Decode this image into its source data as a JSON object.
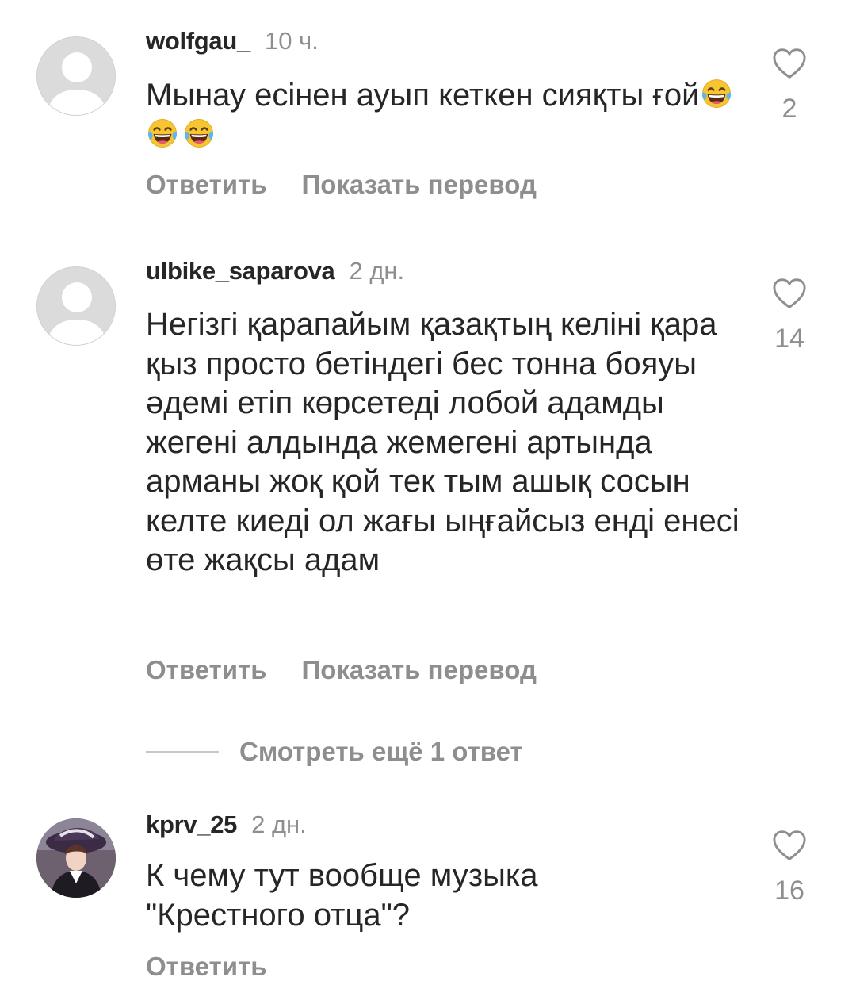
{
  "comments": [
    {
      "username": "wolfgau_",
      "time": "10 ч.",
      "text": "Мынау есінен ауып кеткен сияқты ғой",
      "emoji_count": 3,
      "emoji_icon": "laughing-tears-emoji",
      "likes": "2",
      "reply_label": "Ответить",
      "translate_label": "Показать перевод"
    },
    {
      "username": "ulbike_saparova",
      "time": "2 дн.",
      "text": "Негізгі қарапайым қазақтың келіні қара қыз просто бетіндегі бес тонна бояуы әдемі етіп көрсетеді лобой адамды жегені алдында жемегені артында арманы жоқ қой тек тым ашық сосын келте киеді ол жағы ыңғайсыз енді енесі өте жақсы адам",
      "likes": "14",
      "reply_label": "Ответить",
      "translate_label": "Показать перевод",
      "more_replies_label": "Смотреть ещё 1 ответ"
    },
    {
      "username": "kprv_25",
      "time": "2 дн.",
      "text": "К чему тут вообще музыка \"Крестного отца\"?",
      "likes": "16",
      "reply_label": "Ответить"
    }
  ],
  "icons": {
    "like": "heart-outline-icon",
    "default_avatar": "default-avatar-icon"
  },
  "colors": {
    "text": "#262626",
    "secondary": "#8e8e8e",
    "avatar_bg": "#dbdbdb"
  }
}
